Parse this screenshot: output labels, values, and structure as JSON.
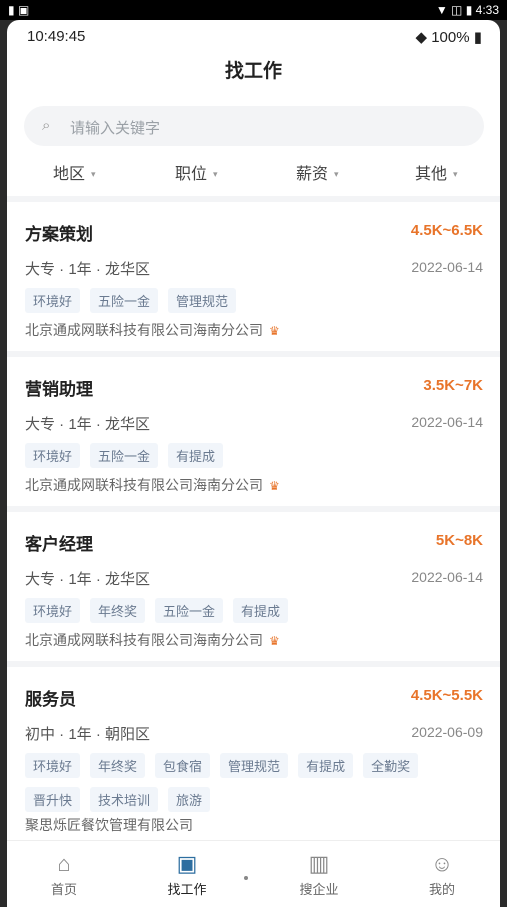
{
  "system_bar": {
    "time": "4:33"
  },
  "status": {
    "time": "10:49:45",
    "battery": "100%"
  },
  "header": {
    "title": "找工作"
  },
  "search": {
    "placeholder": "请输入关键字"
  },
  "filters": [
    "地区",
    "职位",
    "薪资",
    "其他"
  ],
  "jobs": [
    {
      "title": "方案策划",
      "salary": "4.5K~6.5K",
      "meta": "大专 · 1年 · 龙华区",
      "date": "2022-06-14",
      "tags": [
        "环境好",
        "五险一金",
        "管理规范"
      ],
      "company": "北京通成网联科技有限公司海南分公司",
      "crown": true
    },
    {
      "title": "营销助理",
      "salary": "3.5K~7K",
      "meta": "大专 · 1年 · 龙华区",
      "date": "2022-06-14",
      "tags": [
        "环境好",
        "五险一金",
        "有提成"
      ],
      "company": "北京通成网联科技有限公司海南分公司",
      "crown": true
    },
    {
      "title": "客户经理",
      "salary": "5K~8K",
      "meta": "大专 · 1年 · 龙华区",
      "date": "2022-06-14",
      "tags": [
        "环境好",
        "年终奖",
        "五险一金",
        "有提成"
      ],
      "company": "北京通成网联科技有限公司海南分公司",
      "crown": true
    },
    {
      "title": "服务员",
      "salary": "4.5K~5.5K",
      "meta": "初中 · 1年 · 朝阳区",
      "date": "2022-06-09",
      "tags": [
        "环境好",
        "年终奖",
        "包食宿",
        "管理规范",
        "有提成",
        "全勤奖",
        "晋升快",
        "技术培训",
        "旅游"
      ],
      "company": "聚思烁匠餐饮管理有限公司",
      "crown": false
    }
  ],
  "tabbar": {
    "home": "首页",
    "find_job": "找工作",
    "companies": "搜企业",
    "mine": "我的"
  },
  "colors": {
    "accent": "#e8742a",
    "tag_text": "#6a7a90",
    "active_tab": "#2d6ea0"
  }
}
